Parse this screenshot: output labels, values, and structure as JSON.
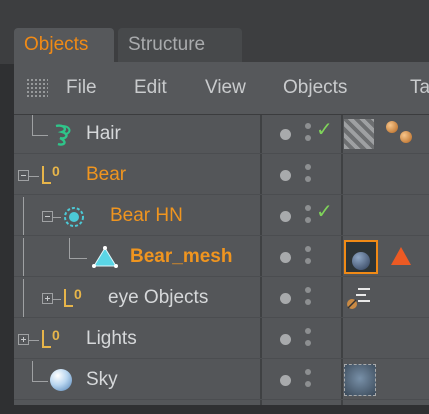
{
  "tabs": {
    "objects": "Objects",
    "structure": "Structure"
  },
  "menu": [
    "File",
    "Edit",
    "View",
    "Objects",
    "Tag"
  ],
  "rows": [
    {
      "name": "Hair",
      "tag": "hair-materials"
    },
    {
      "name": "Bear"
    },
    {
      "name": "Bear HN"
    },
    {
      "name": "Bear_mesh"
    },
    {
      "name": "eye Objects"
    },
    {
      "name": "Lights"
    },
    {
      "name": "Sky"
    }
  ],
  "colors": {
    "accent": "#f08a16",
    "check": "#7fd35a"
  }
}
